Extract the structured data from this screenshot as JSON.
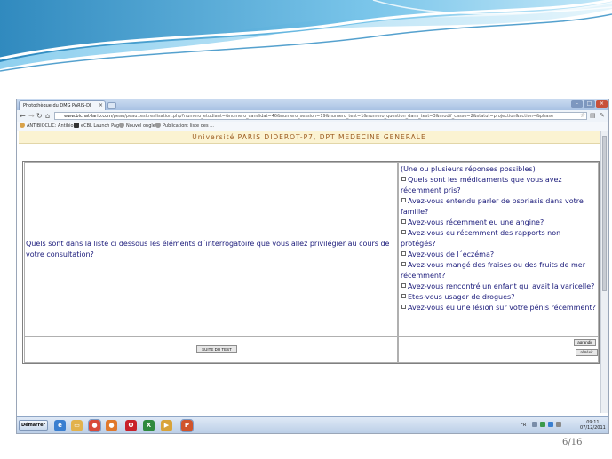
{
  "browser": {
    "tab_title": "Photothèque du DMG PARIS-DI",
    "url_host": "www.bichat-larib.com",
    "url_path": "/peau/peau.test.realisation.php?numero_etudiant=&numero_candidat=46&numero_session=19&numero_test=1&numero_question_dans_test=3&modif_casse=2&statut=projection&action=&phase",
    "bookmarks": [
      "ANTIBIOCLIC: Antibio...",
      "eCBL Launch Page",
      "Nouvel onglet",
      "Publication: liste des ..."
    ]
  },
  "page": {
    "header": "Université PARIS DIDEROT-P7, DPT MEDECINE GENERALE",
    "question": "Quels sont dans la liste ci dessous les éléments d´interrogatoire que vous allez privilégier au cours de votre consultation?",
    "answers_hint": "(Une ou plusieurs réponses possibles)",
    "options": [
      "Quels sont les médicaments que vous avez récemment pris?",
      "Avez-vous entendu parler de psoriasis dans votre famille?",
      "Avez-vous récemment eu une angine?",
      "Avez-vous eu récemment des rapports non protégés?",
      "Avez-vous de l´eczéma?",
      "Avez-vous mangé des fraises ou des fruits de mer récemment?",
      "Avez-vous rencontré un enfant qui avait la varicelle?",
      "Etes-vous usager de drogues?",
      "Avez-vous eu une lésion sur votre pénis récemment?"
    ],
    "next_button": "SUITE DU TEST",
    "enlarge_button": "agrandir",
    "shrink_button": "rétrécir"
  },
  "taskbar": {
    "start_label": "Démarrer",
    "language": "FR",
    "time": "09:11",
    "date": "07/12/2011"
  },
  "slide": {
    "number": "6/16"
  },
  "colors": {
    "header_text": "#9b5a1f",
    "header_bg": "#fbf3d2",
    "question_text": "#1a1a7a"
  }
}
